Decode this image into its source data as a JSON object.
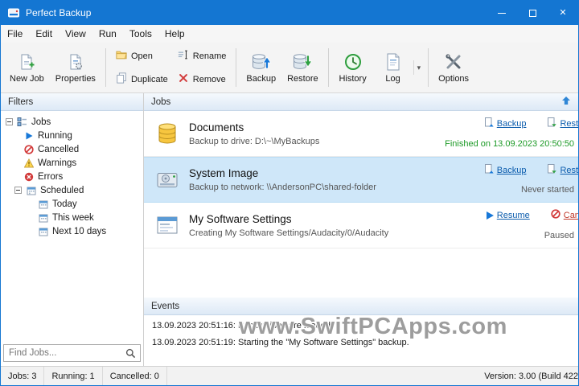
{
  "window": {
    "title": "Perfect Backup"
  },
  "menu": {
    "items": [
      "File",
      "Edit",
      "View",
      "Run",
      "Tools",
      "Help"
    ]
  },
  "toolbar": {
    "buttons": {
      "new_job": "New Job",
      "properties": "Properties",
      "open": "Open",
      "duplicate": "Duplicate",
      "rename": "Rename",
      "remove": "Remove",
      "backup": "Backup",
      "restore": "Restore",
      "history": "History",
      "log": "Log",
      "options": "Options"
    }
  },
  "filters": {
    "header": "Filters",
    "tree": [
      {
        "label": "Jobs",
        "icon": "jobs-folder-icon"
      },
      {
        "label": "Running",
        "icon": "running-icon"
      },
      {
        "label": "Cancelled",
        "icon": "cancelled-icon"
      },
      {
        "label": "Warnings",
        "icon": "warning-icon"
      },
      {
        "label": "Errors",
        "icon": "error-icon"
      },
      {
        "label": "Scheduled",
        "icon": "calendar-icon"
      },
      {
        "label": "Today",
        "icon": "calendar-icon"
      },
      {
        "label": "This week",
        "icon": "calendar-icon"
      },
      {
        "label": "Next 10 days",
        "icon": "calendar-icon"
      }
    ],
    "search": {
      "placeholder": "Find Jobs..."
    }
  },
  "jobs": {
    "header": "Jobs",
    "items": [
      {
        "title": "Documents",
        "subtitle": "Backup to drive: D:\\~\\MyBackups",
        "actions": [
          "Backup",
          "Restore"
        ],
        "status": "Finished on 13.09.2023 20:50:50",
        "status_color": "#1d9a27"
      },
      {
        "title": "System Image",
        "subtitle": "Backup to network: \\\\AndersonPC\\shared-folder",
        "actions": [
          "Backup",
          "Restore"
        ],
        "status": "Never started",
        "status_color": "#5a5a5a"
      },
      {
        "title": "My Software Settings",
        "subtitle": "Creating My Software Settings/Audacity/0/Audacity",
        "actions": [
          "Resume",
          "Cancel"
        ],
        "status": "Paused",
        "status_color": "#5a5a5a"
      }
    ]
  },
  "events": {
    "header": "Events",
    "lines": [
      "13.09.2023 20:51:16: Backup jobs are loaded.",
      "13.09.2023 20:51:19: Starting the \"My Software Settings\" backup."
    ],
    "watermark": "www.SwiftPCApps.com"
  },
  "statusbar": {
    "jobs": "Jobs: 3",
    "running": "Running: 1",
    "cancelled": "Cancelled: 0",
    "version": "Version: 3.00 (Build 422"
  }
}
